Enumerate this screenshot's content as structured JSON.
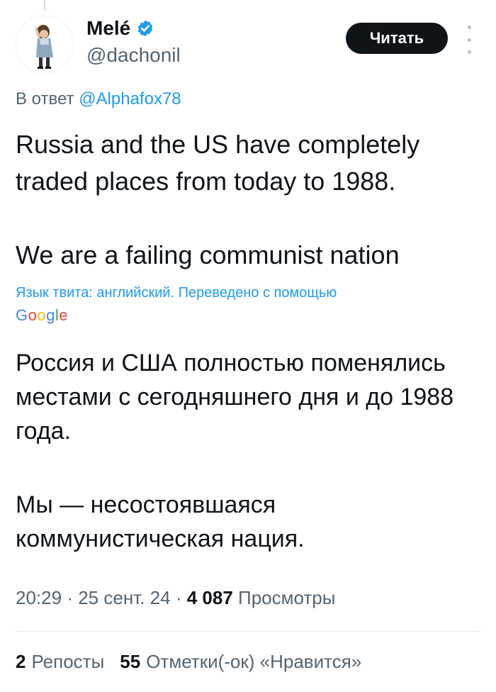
{
  "author": {
    "display_name": "Melé",
    "handle": "@dachonil"
  },
  "follow_button": "Читать",
  "reply": {
    "prefix": "В ответ",
    "mention": "@Alphafox78"
  },
  "tweet": {
    "paragraph_1": "Russia and the US have completely traded places from today to 1988.",
    "paragraph_2": "We are a failing communist nation"
  },
  "translation": {
    "note": "Язык твита: английский. Переведено с помощью",
    "provider": "Google",
    "paragraph_1": "Россия и США полностью поменялись местами с сегодняшнего дня и до 1988 года.",
    "paragraph_2": "Мы — несостоявшаяся коммунистическая нация."
  },
  "meta": {
    "time": "20:29",
    "date": "25 сент. 24",
    "views_count": "4 087",
    "views_label": "Просмотры"
  },
  "stats": {
    "reposts_count": "2",
    "reposts_label": "Репосты",
    "likes_count": "55",
    "likes_label": "Отметки(-ок) «Нравится»"
  },
  "colors": {
    "accent": "#1d9bf0",
    "text": "#0f1419",
    "muted": "#536471"
  }
}
